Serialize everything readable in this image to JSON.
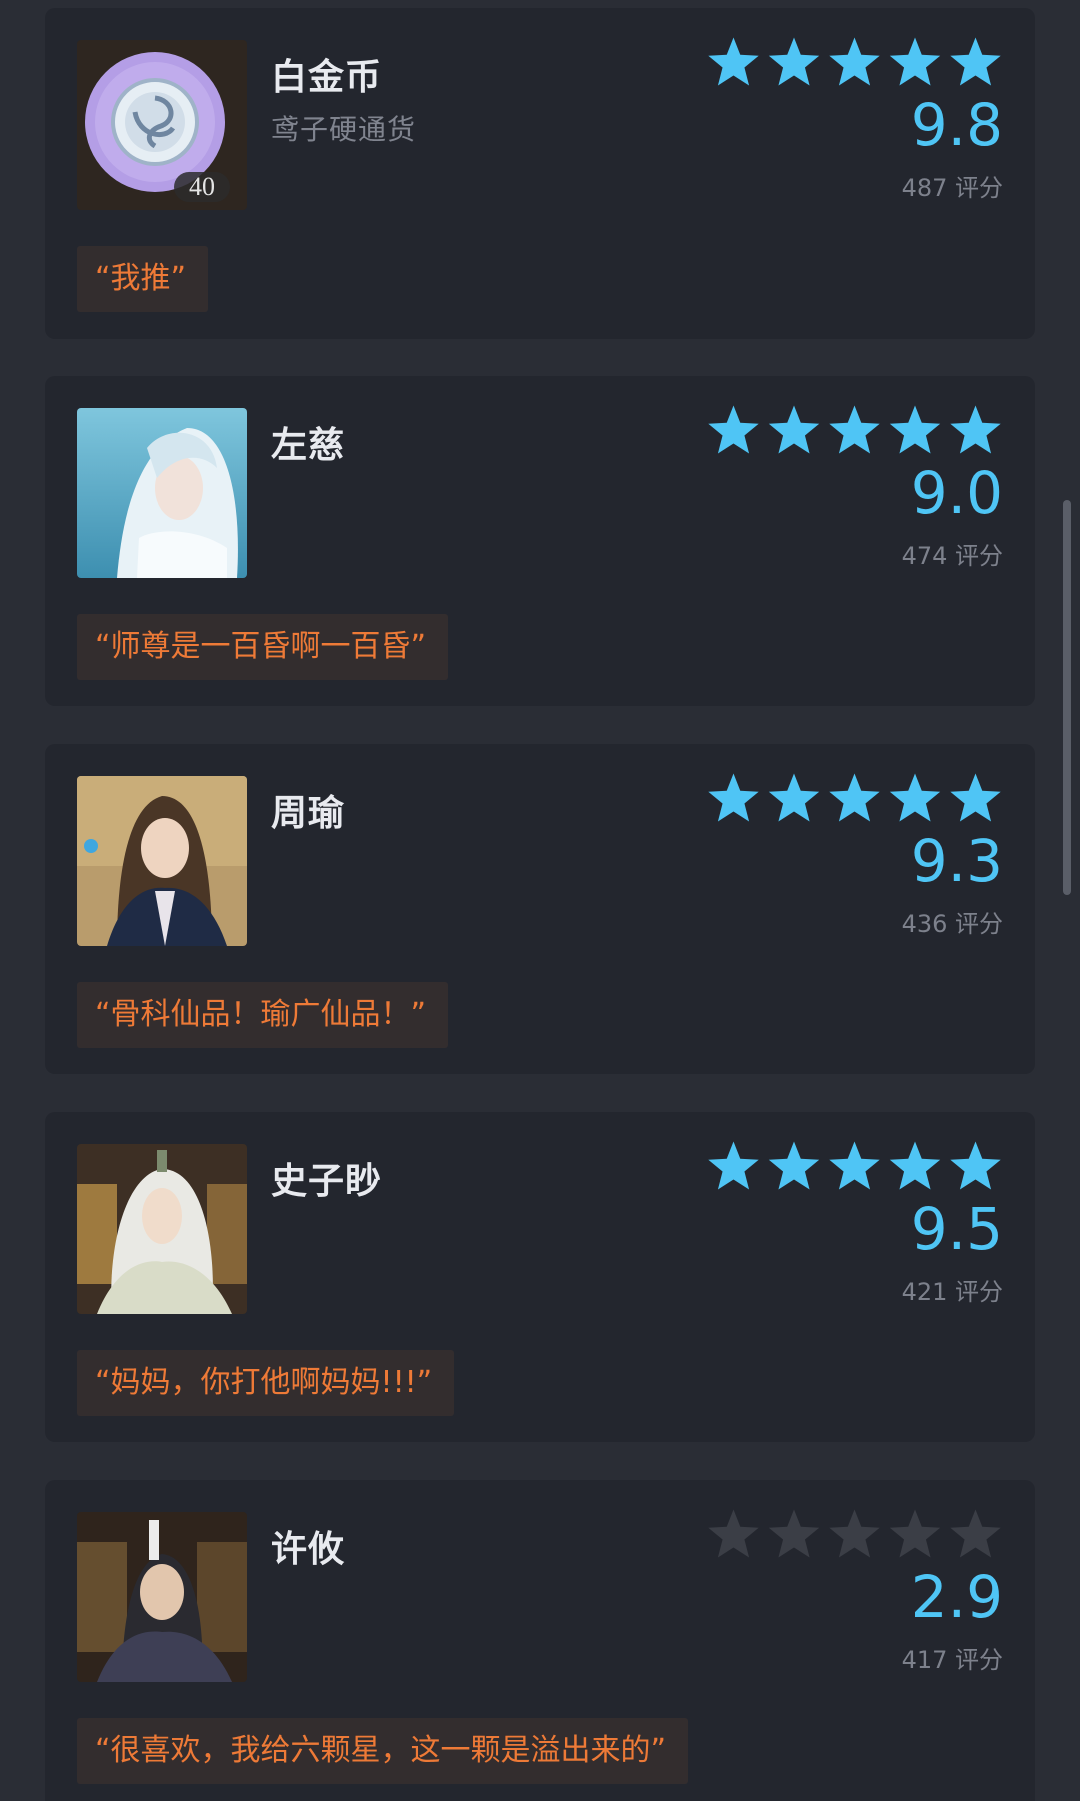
{
  "colors": {
    "page_bg": "#2a2d35",
    "card_bg": "#23262e",
    "star_filled": "#4fc5f5",
    "star_empty": "#3b3e46",
    "score": "#4fc5f5",
    "quote_text": "#ee7a37",
    "quote_bg": "#332d2e"
  },
  "items": [
    {
      "name": "白金币",
      "subtitle": "鸢子硬通货",
      "badge": "40",
      "stars_filled": 5,
      "score": "9.8",
      "count": "487 评分",
      "quote": "“我推”"
    },
    {
      "name": "左慈",
      "stars_filled": 5,
      "score": "9.0",
      "count": "474 评分",
      "quote": "“师尊是一百昏啊一百昏”"
    },
    {
      "name": "周瑜",
      "stars_filled": 5,
      "score": "9.3",
      "count": "436 评分",
      "quote": "“骨科仙品！瑜广仙品！”"
    },
    {
      "name": "史子眇",
      "stars_filled": 5,
      "score": "9.5",
      "count": "421 评分",
      "quote": "“妈妈，你打他啊妈妈!!!”"
    },
    {
      "name": "许攸",
      "stars_filled": 0,
      "score": "2.9",
      "count": "417 评分",
      "quote": "“很喜欢，我给六颗星，这一颗是溢出来的”"
    }
  ]
}
